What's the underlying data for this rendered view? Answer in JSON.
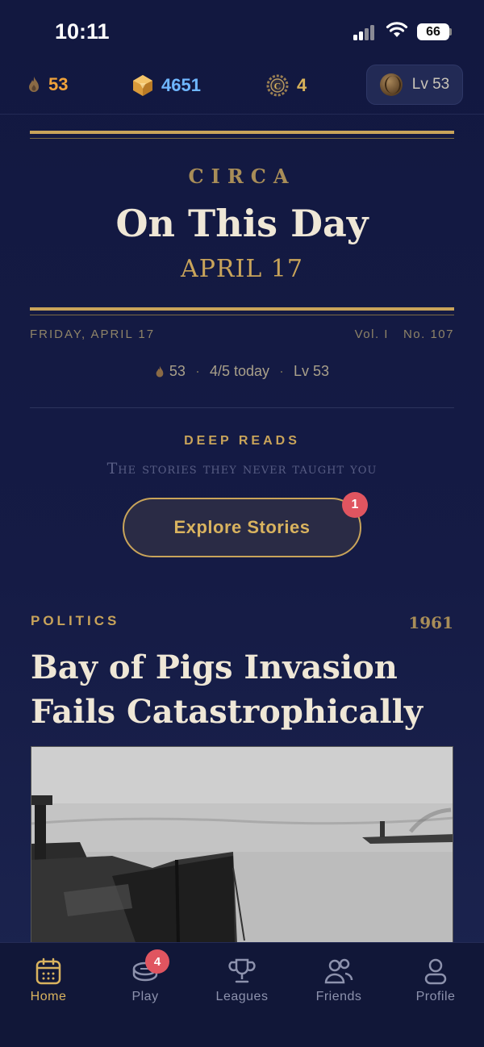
{
  "status_bar": {
    "time": "10:11",
    "battery": "66"
  },
  "stats": {
    "flames": "53",
    "gems": "4651",
    "coins": "4",
    "level": "Lv 53"
  },
  "masthead": {
    "kicker": "CIRCA",
    "title": "On This Day",
    "date": "APRIL 17",
    "dateline": "FRIDAY, APRIL 17",
    "volume": "Vol. I",
    "number": "No. 107"
  },
  "meta": {
    "streak": "53",
    "progress": "4/5 today",
    "level": "Lv 53"
  },
  "deep_reads": {
    "label": "DEEP READS",
    "subtitle": "The stories they never taught you",
    "button_label": "Explore Stories",
    "badge": "1"
  },
  "story": {
    "category": "POLITICS",
    "year": "1961",
    "title": "Bay of Pigs Invasion Fails Catastrophically"
  },
  "tab_bar": {
    "tabs": [
      {
        "label": "Home",
        "icon": "calendar-icon",
        "active": true
      },
      {
        "label": "Play",
        "icon": "play-disc-icon",
        "badge": "4"
      },
      {
        "label": "Leagues",
        "icon": "trophy-icon"
      },
      {
        "label": "Friends",
        "icon": "friends-icon"
      },
      {
        "label": "Profile",
        "icon": "profile-icon"
      }
    ]
  },
  "colors": {
    "background": "#121840",
    "accent_gold": "#c9a45a",
    "gem_blue": "#6fb6ff",
    "flame_orange": "#f0a23a",
    "badge_red": "#e05560"
  }
}
